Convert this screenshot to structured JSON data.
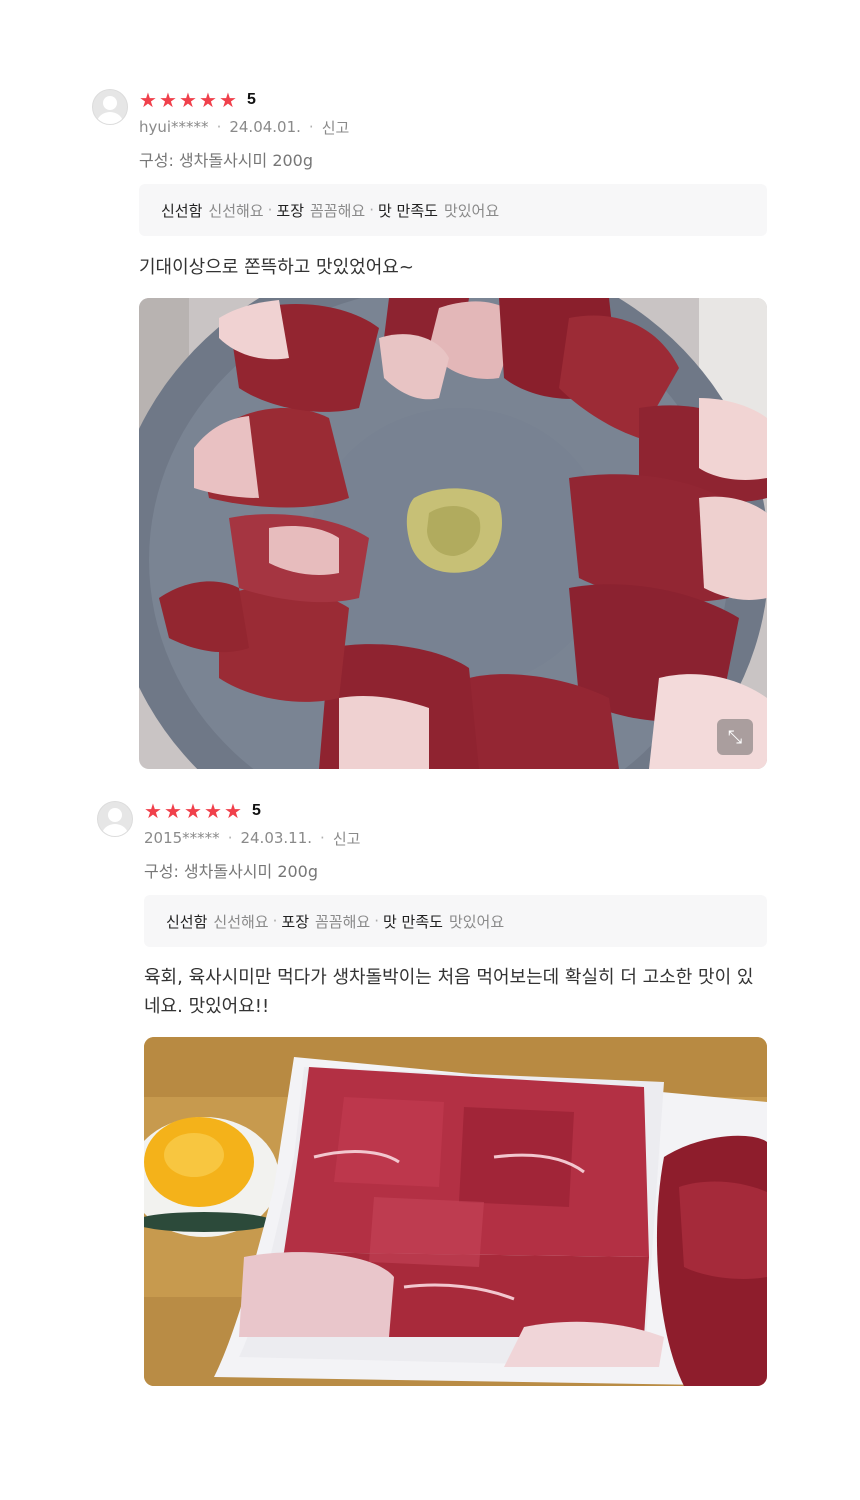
{
  "reviews": [
    {
      "rating_stars": "★★★★★",
      "score": "5",
      "author": "hyui*****",
      "date": "24.04.01.",
      "report_label": "신고",
      "option": "구성: 생차돌사시미 200g",
      "tags": [
        {
          "key": "신선함",
          "value": "신선해요"
        },
        {
          "key": "포장",
          "value": "꼼꼼해요"
        },
        {
          "key": "맛 만족도",
          "value": "맛있어요"
        }
      ],
      "text": "기대이상으로 쫀뜩하고 맛있었어요~",
      "photo_icon": "expand-icon"
    },
    {
      "rating_stars": "★★★★★",
      "score": "5",
      "author": "2015*****",
      "date": "24.03.11.",
      "report_label": "신고",
      "option": "구성: 생차돌사시미 200g",
      "tags": [
        {
          "key": "신선함",
          "value": "신선해요"
        },
        {
          "key": "포장",
          "value": "꼼꼼해요"
        },
        {
          "key": "맛 만족도",
          "value": "맛있어요"
        }
      ],
      "text": "육회, 육사시미만 먹다가 생차돌박이는 처음 먹어보는데 확실히 더 고소한 맛이 있네요. 맛있어요!!"
    }
  ],
  "separator": "·",
  "colors": {
    "star": "#f0404b",
    "tag_bg": "#f7f7f8",
    "meta_gray": "#8a8a8a"
  }
}
